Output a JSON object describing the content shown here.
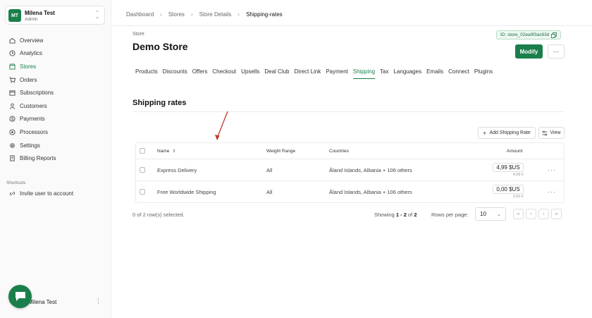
{
  "workspace": {
    "avatar": "MT",
    "name": "Milena Test",
    "role": "Admin"
  },
  "sidebar": {
    "items": [
      {
        "label": "Overview",
        "icon": "home-icon",
        "active": false
      },
      {
        "label": "Analytics",
        "icon": "clock-icon",
        "active": false
      },
      {
        "label": "Stores",
        "icon": "store-icon",
        "active": true
      },
      {
        "label": "Orders",
        "icon": "cart-icon",
        "active": false
      },
      {
        "label": "Subscriptions",
        "icon": "subscriptions-icon",
        "active": false
      },
      {
        "label": "Customers",
        "icon": "users-icon",
        "active": false
      },
      {
        "label": "Payments",
        "icon": "dollar-icon",
        "active": false
      },
      {
        "label": "Processors",
        "icon": "processor-icon",
        "active": false
      },
      {
        "label": "Settings",
        "icon": "gear-icon",
        "active": false
      },
      {
        "label": "Billing Reports",
        "icon": "report-icon",
        "active": false
      }
    ],
    "shortcuts_title": "Shortcuts",
    "shortcut": "Invite user to account",
    "footer_name": "Milena Test"
  },
  "breadcrumb": [
    "Dashboard",
    "Stores",
    "Store Details",
    "Shipping-rates"
  ],
  "store": {
    "label": "Store",
    "title": "Demo Store",
    "id": "ID: store_02ea9f3ac63d",
    "modify_label": "Modify"
  },
  "tabs": [
    "Products",
    "Discounts",
    "Offers",
    "Checkout",
    "Upsells",
    "Deal Club",
    "Direct Link",
    "Payment",
    "Shipping",
    "Tax",
    "Languages",
    "Emails",
    "Connect",
    "Plugins"
  ],
  "active_tab": "Shipping",
  "section": {
    "title": "Shipping rates",
    "add_button": "Add Shipping Rate",
    "view_button": "View"
  },
  "table": {
    "columns": {
      "name": "Name",
      "weight": "Weight Range",
      "countries": "Countries",
      "amount": "Amount"
    },
    "rows": [
      {
        "name": "Express Delivery",
        "weight": "All",
        "countries": "Åland Islands, Albania + 106 others",
        "amount": "4,99 $US",
        "amount_sub": "4,58 €"
      },
      {
        "name": "Free Worldwide Shipping",
        "weight": "All",
        "countries": "Åland Islands, Albania + 106 others",
        "amount": "0,00 $US",
        "amount_sub": "0,00 €"
      }
    ]
  },
  "pagination": {
    "selected": "0 of 2 row(s) selected.",
    "showing_prefix": "Showing ",
    "showing_range": "1 - 2",
    "showing_of": " of ",
    "showing_total": "2",
    "rows_per_page_label": "Rows per page:",
    "rows_per_page": "10"
  },
  "colors": {
    "brand": "#1a7f4b",
    "annotation_arrow": "#c0392b"
  }
}
